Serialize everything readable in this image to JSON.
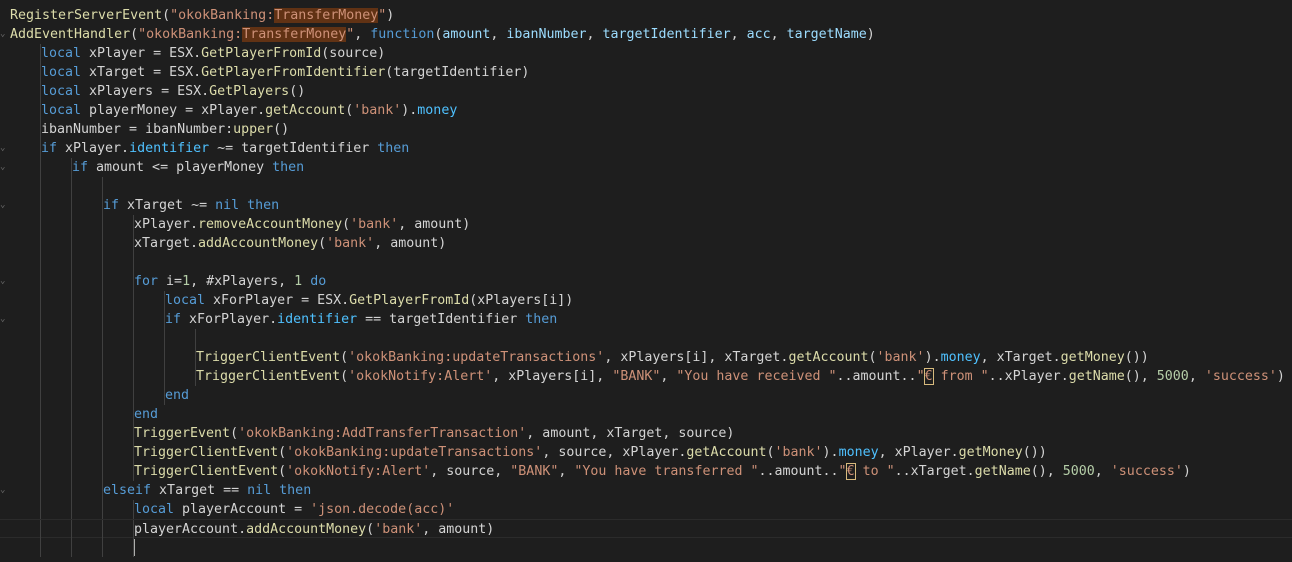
{
  "editor": {
    "language": "lua",
    "lines": [
      {
        "indent": 0,
        "fold": false,
        "tokens": [
          [
            "fn",
            "RegisterServerEvent"
          ],
          [
            "def",
            "("
          ],
          [
            "str",
            "\"okokBanking:"
          ],
          [
            "hl",
            "TransferMoney"
          ],
          [
            "str",
            "\""
          ],
          [
            "def",
            ")"
          ]
        ]
      },
      {
        "indent": 0,
        "fold": true,
        "tokens": [
          [
            "fn",
            "AddEventHandler"
          ],
          [
            "def",
            "("
          ],
          [
            "str",
            "\"okokBanking:"
          ],
          [
            "hl",
            "TransferMoney"
          ],
          [
            "str",
            "\""
          ],
          [
            "def",
            ", "
          ],
          [
            "kw",
            "function"
          ],
          [
            "def",
            "("
          ],
          [
            "var",
            "amount"
          ],
          [
            "def",
            ", "
          ],
          [
            "var",
            "ibanNumber"
          ],
          [
            "def",
            ", "
          ],
          [
            "var",
            "targetIdentifier"
          ],
          [
            "def",
            ", "
          ],
          [
            "var",
            "acc"
          ],
          [
            "def",
            ", "
          ],
          [
            "var",
            "targetName"
          ],
          [
            "def",
            ")"
          ]
        ]
      },
      {
        "indent": 1,
        "fold": false,
        "tokens": [
          [
            "kw",
            "local"
          ],
          [
            "def",
            " xPlayer = ESX."
          ],
          [
            "fn",
            "GetPlayerFromId"
          ],
          [
            "def",
            "(source)"
          ]
        ]
      },
      {
        "indent": 1,
        "fold": false,
        "tokens": [
          [
            "kw",
            "local"
          ],
          [
            "def",
            " xTarget = ESX."
          ],
          [
            "fn",
            "GetPlayerFromIdentifier"
          ],
          [
            "def",
            "(targetIdentifier)"
          ]
        ]
      },
      {
        "indent": 1,
        "fold": false,
        "tokens": [
          [
            "kw",
            "local"
          ],
          [
            "def",
            " xPlayers = ESX."
          ],
          [
            "fn",
            "GetPlayers"
          ],
          [
            "def",
            "()"
          ]
        ]
      },
      {
        "indent": 1,
        "fold": false,
        "tokens": [
          [
            "kw",
            "local"
          ],
          [
            "def",
            " playerMoney = xPlayer."
          ],
          [
            "fn",
            "getAccount"
          ],
          [
            "def",
            "("
          ],
          [
            "str",
            "'bank'"
          ],
          [
            "def",
            ")."
          ],
          [
            "prop",
            "money"
          ]
        ]
      },
      {
        "indent": 1,
        "fold": false,
        "tokens": [
          [
            "def",
            "ibanNumber = ibanNumber:"
          ],
          [
            "fn",
            "upper"
          ],
          [
            "def",
            "()"
          ]
        ]
      },
      {
        "indent": 1,
        "fold": true,
        "tokens": [
          [
            "kw",
            "if"
          ],
          [
            "def",
            " xPlayer."
          ],
          [
            "prop",
            "identifier"
          ],
          [
            "def",
            " ~= targetIdentifier "
          ],
          [
            "kw",
            "then"
          ]
        ]
      },
      {
        "indent": 2,
        "fold": true,
        "tokens": [
          [
            "kw",
            "if"
          ],
          [
            "def",
            " amount <= playerMoney "
          ],
          [
            "kw",
            "then"
          ]
        ]
      },
      {
        "indent": 3,
        "fold": false,
        "tokens": []
      },
      {
        "indent": 3,
        "fold": true,
        "tokens": [
          [
            "kw",
            "if"
          ],
          [
            "def",
            " xTarget ~= "
          ],
          [
            "kw",
            "nil"
          ],
          [
            "def",
            " "
          ],
          [
            "kw",
            "then"
          ]
        ]
      },
      {
        "indent": 4,
        "fold": false,
        "tokens": [
          [
            "def",
            "xPlayer."
          ],
          [
            "fn",
            "removeAccountMoney"
          ],
          [
            "def",
            "("
          ],
          [
            "str",
            "'bank'"
          ],
          [
            "def",
            ", amount)"
          ]
        ]
      },
      {
        "indent": 4,
        "fold": false,
        "tokens": [
          [
            "def",
            "xTarget."
          ],
          [
            "fn",
            "addAccountMoney"
          ],
          [
            "def",
            "("
          ],
          [
            "str",
            "'bank'"
          ],
          [
            "def",
            ", amount)"
          ]
        ]
      },
      {
        "indent": 4,
        "fold": false,
        "tokens": []
      },
      {
        "indent": 4,
        "fold": true,
        "tokens": [
          [
            "kw",
            "for"
          ],
          [
            "def",
            " i="
          ],
          [
            "num",
            "1"
          ],
          [
            "def",
            ", #xPlayers, "
          ],
          [
            "num",
            "1"
          ],
          [
            "def",
            " "
          ],
          [
            "kw",
            "do"
          ]
        ]
      },
      {
        "indent": 5,
        "fold": false,
        "tokens": [
          [
            "kw",
            "local"
          ],
          [
            "def",
            " xForPlayer = ESX."
          ],
          [
            "fn",
            "GetPlayerFromId"
          ],
          [
            "def",
            "(xPlayers[i])"
          ]
        ]
      },
      {
        "indent": 5,
        "fold": true,
        "tokens": [
          [
            "kw",
            "if"
          ],
          [
            "def",
            " xForPlayer."
          ],
          [
            "prop",
            "identifier"
          ],
          [
            "def",
            " == targetIdentifier "
          ],
          [
            "kw",
            "then"
          ]
        ]
      },
      {
        "indent": 6,
        "fold": false,
        "tokens": []
      },
      {
        "indent": 6,
        "fold": false,
        "tokens": [
          [
            "fn",
            "TriggerClientEvent"
          ],
          [
            "def",
            "("
          ],
          [
            "str",
            "'okokBanking:updateTransactions'"
          ],
          [
            "def",
            ", xPlayers[i], xTarget."
          ],
          [
            "fn",
            "getAccount"
          ],
          [
            "def",
            "("
          ],
          [
            "str",
            "'bank'"
          ],
          [
            "def",
            ")."
          ],
          [
            "prop",
            "money"
          ],
          [
            "def",
            ", xTarget."
          ],
          [
            "fn",
            "getMoney"
          ],
          [
            "def",
            "())"
          ]
        ]
      },
      {
        "indent": 6,
        "fold": false,
        "tokens": [
          [
            "fn",
            "TriggerClientEvent"
          ],
          [
            "def",
            "("
          ],
          [
            "str",
            "'okokNotify:Alert'"
          ],
          [
            "def",
            ", xPlayers[i], "
          ],
          [
            "str",
            "\"BANK\""
          ],
          [
            "def",
            ", "
          ],
          [
            "str",
            "\"You have received \""
          ],
          [
            "def",
            "..amount.."
          ],
          [
            "str",
            "\""
          ],
          [
            "box",
            "€"
          ],
          [
            "str",
            " from \""
          ],
          [
            "def",
            "..xPlayer."
          ],
          [
            "fn",
            "getName"
          ],
          [
            "def",
            "(), "
          ],
          [
            "num",
            "5000"
          ],
          [
            "def",
            ", "
          ],
          [
            "str",
            "'success'"
          ],
          [
            "def",
            ")"
          ]
        ]
      },
      {
        "indent": 5,
        "fold": false,
        "tokens": [
          [
            "kw",
            "end"
          ]
        ]
      },
      {
        "indent": 4,
        "fold": false,
        "tokens": [
          [
            "kw",
            "end"
          ]
        ]
      },
      {
        "indent": 4,
        "fold": false,
        "tokens": [
          [
            "fn",
            "TriggerEvent"
          ],
          [
            "def",
            "("
          ],
          [
            "str",
            "'okokBanking:AddTransferTransaction'"
          ],
          [
            "def",
            ", amount, xTarget, source)"
          ]
        ]
      },
      {
        "indent": 4,
        "fold": false,
        "tokens": [
          [
            "fn",
            "TriggerClientEvent"
          ],
          [
            "def",
            "("
          ],
          [
            "str",
            "'okokBanking:updateTransactions'"
          ],
          [
            "def",
            ", source, xPlayer."
          ],
          [
            "fn",
            "getAccount"
          ],
          [
            "def",
            "("
          ],
          [
            "str",
            "'bank'"
          ],
          [
            "def",
            ")."
          ],
          [
            "prop",
            "money"
          ],
          [
            "def",
            ", xPlayer."
          ],
          [
            "fn",
            "getMoney"
          ],
          [
            "def",
            "())"
          ]
        ]
      },
      {
        "indent": 4,
        "fold": false,
        "tokens": [
          [
            "fn",
            "TriggerClientEvent"
          ],
          [
            "def",
            "("
          ],
          [
            "str",
            "'okokNotify:Alert'"
          ],
          [
            "def",
            ", source, "
          ],
          [
            "str",
            "\"BANK\""
          ],
          [
            "def",
            ", "
          ],
          [
            "str",
            "\"You have transferred \""
          ],
          [
            "def",
            "..amount.."
          ],
          [
            "str",
            "\""
          ],
          [
            "box",
            "€"
          ],
          [
            "str",
            " to \""
          ],
          [
            "def",
            "..xTarget."
          ],
          [
            "fn",
            "getName"
          ],
          [
            "def",
            "(), "
          ],
          [
            "num",
            "5000"
          ],
          [
            "def",
            ", "
          ],
          [
            "str",
            "'success'"
          ],
          [
            "def",
            ")"
          ]
        ]
      },
      {
        "indent": 3,
        "fold": true,
        "tokens": [
          [
            "kw",
            "elseif"
          ],
          [
            "def",
            " xTarget == "
          ],
          [
            "kw",
            "nil"
          ],
          [
            "def",
            " "
          ],
          [
            "kw",
            "then"
          ]
        ]
      },
      {
        "indent": 4,
        "fold": false,
        "tokens": [
          [
            "kw",
            "local"
          ],
          [
            "def",
            " playerAccount = "
          ],
          [
            "str",
            "'json.decode(acc)'"
          ]
        ]
      },
      {
        "indent": 4,
        "fold": false,
        "tokens": [
          [
            "def",
            "playerAccount."
          ],
          [
            "fn",
            "addAccountMoney"
          ],
          [
            "def",
            "("
          ],
          [
            "str",
            "'bank'"
          ],
          [
            "def",
            ", amount)"
          ]
        ]
      },
      {
        "indent": 4,
        "fold": false,
        "tokens": []
      }
    ]
  }
}
